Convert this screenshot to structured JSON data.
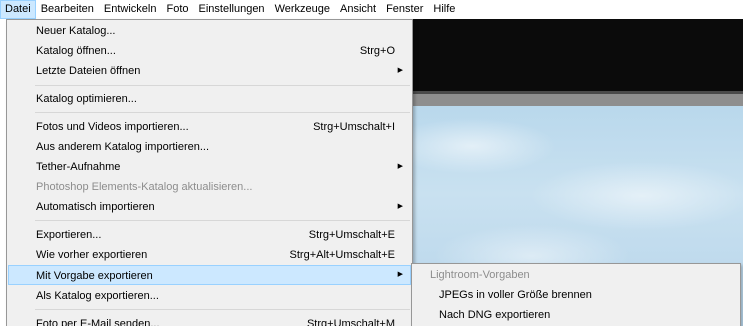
{
  "menubar": {
    "items": [
      "Datei",
      "Bearbeiten",
      "Entwickeln",
      "Foto",
      "Einstellungen",
      "Werkzeuge",
      "Ansicht",
      "Fenster",
      "Hilfe"
    ]
  },
  "file_menu": {
    "items": [
      {
        "label": "Neuer Katalog...",
        "shortcut": ""
      },
      {
        "label": "Katalog öffnen...",
        "shortcut": "Strg+O"
      },
      {
        "label": "Letzte Dateien öffnen",
        "shortcut": ""
      },
      {
        "label": "Katalog optimieren...",
        "shortcut": ""
      },
      {
        "label": "Fotos und Videos importieren...",
        "shortcut": "Strg+Umschalt+I"
      },
      {
        "label": "Aus anderem Katalog importieren...",
        "shortcut": ""
      },
      {
        "label": "Tether-Aufnahme",
        "shortcut": ""
      },
      {
        "label": "Photoshop Elements-Katalog aktualisieren...",
        "shortcut": ""
      },
      {
        "label": "Automatisch importieren",
        "shortcut": ""
      },
      {
        "label": "Exportieren...",
        "shortcut": "Strg+Umschalt+E"
      },
      {
        "label": "Wie vorher exportieren",
        "shortcut": "Strg+Alt+Umschalt+E"
      },
      {
        "label": "Mit Vorgabe exportieren",
        "shortcut": ""
      },
      {
        "label": "Als Katalog exportieren...",
        "shortcut": ""
      },
      {
        "label": "Foto per E-Mail senden...",
        "shortcut": "Strg+Umschalt+M"
      }
    ]
  },
  "submenu": {
    "header": "Lightroom-Vorgaben",
    "items": [
      "JPEGs in voller Größe brennen",
      "Nach DNG exportieren"
    ]
  },
  "icons": {
    "submenu_arrow": "chevron-right-icon"
  },
  "colors": {
    "highlight": "#cce8ff",
    "highlight_border": "#99d1ff",
    "menu_bg": "#f0f0f0",
    "disabled_text": "#8d8d8d"
  }
}
